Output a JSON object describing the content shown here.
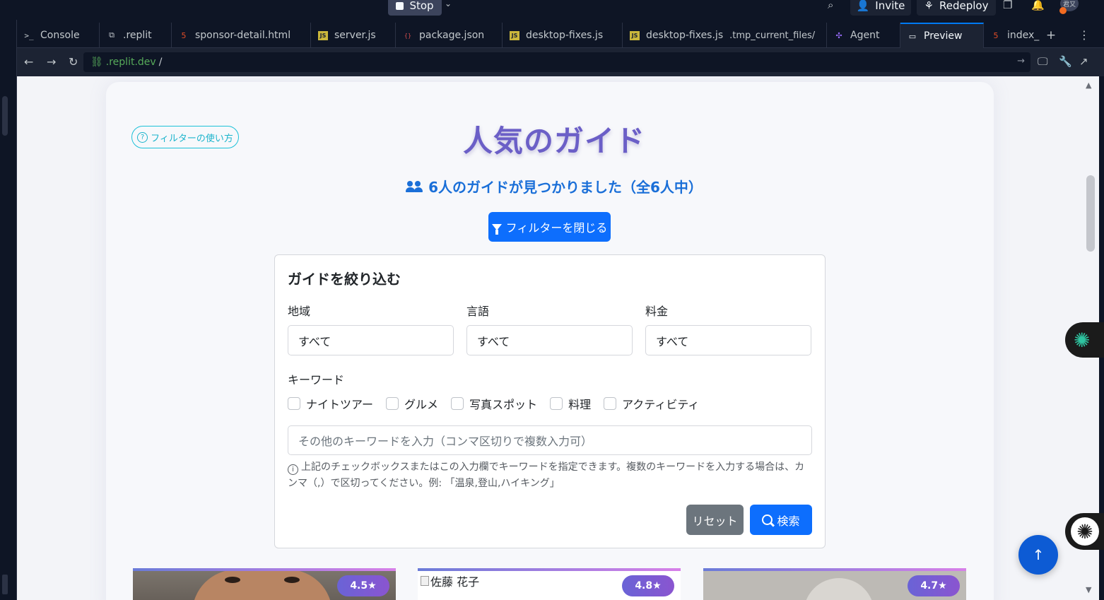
{
  "topbar": {
    "stop_label": "Stop",
    "invite_label": "Invite",
    "redeploy_label": "Redeploy",
    "avatar_text": "君又"
  },
  "tabs": [
    {
      "label": "Console",
      "icon": "console-icon"
    },
    {
      "label": ".replit",
      "icon": "replit-icon"
    },
    {
      "label": "sponsor-detail.html",
      "icon": "html-icon"
    },
    {
      "label": "server.js",
      "icon": "js-icon"
    },
    {
      "label": "package.json",
      "icon": "json-icon"
    },
    {
      "label": "desktop-fixes.js",
      "icon": "js-icon"
    },
    {
      "label": "desktop-fixes.js",
      "sublabel": ".tmp_current_files/",
      "icon": "js-icon"
    },
    {
      "label": "Agent",
      "icon": "agent-icon"
    },
    {
      "label": "Preview",
      "icon": "monitor-icon",
      "active": true
    },
    {
      "label": "index_",
      "icon": "html-icon"
    }
  ],
  "address": {
    "host": ".replit.dev",
    "path": "/"
  },
  "page": {
    "help_link": "フィルターの使い方",
    "title": "人気のガイド",
    "result_count": "6人のガイドが見つかりました（全6人中）",
    "filter_toggle": "フィルターを閉じる",
    "filter": {
      "title": "ガイドを絞り込む",
      "region_label": "地域",
      "region_value": "すべて",
      "language_label": "言語",
      "language_value": "すべて",
      "fee_label": "料金",
      "fee_value": "すべて",
      "keyword_label": "キーワード",
      "checkboxes": [
        "ナイトツアー",
        "グルメ",
        "写真スポット",
        "料理",
        "アクティビティ"
      ],
      "keyword_placeholder": "その他のキーワードを入力（コンマ区切りで複数入力可）",
      "hint": "上記のチェックボックスまたはこの入力欄でキーワードを指定できます。複数のキーワードを入力する場合は、カンマ（,）で区切ってください。例: 「温泉,登山,ハイキング」",
      "reset_label": "リセット",
      "search_label": "検索"
    },
    "guides": [
      {
        "rating": "4.5★",
        "alt": ""
      },
      {
        "rating": "4.8★",
        "alt": "佐藤 花子"
      },
      {
        "rating": "4.7★",
        "alt": ""
      }
    ]
  },
  "colors": {
    "accent": "#0d6efd",
    "title": "#6b5fc7",
    "ide_bg": "#0e1525",
    "ide_panel": "#1c2333"
  }
}
